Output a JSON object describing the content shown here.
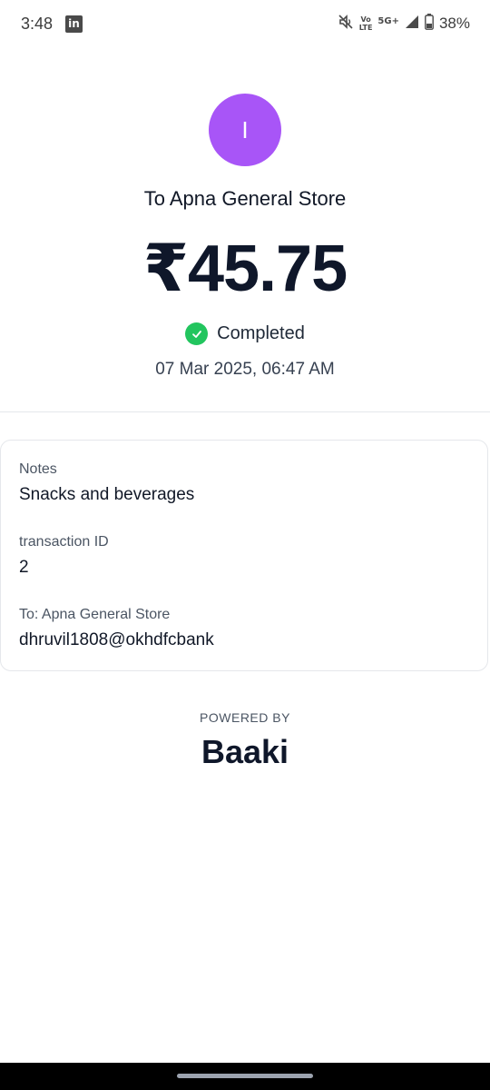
{
  "status_bar": {
    "time": "3:48",
    "battery_percent": "38%",
    "icons": [
      "linkedin-icon",
      "mute-icon",
      "volte-icon",
      "5g-icon",
      "signal-icon",
      "battery-icon"
    ],
    "volte_text": "Vo LTE",
    "network_text": "5G+"
  },
  "payment": {
    "avatar_initial": "I",
    "avatar_color": "#a855f7",
    "title": "To Apna General Store",
    "amount": "₹45.75",
    "status": "Completed",
    "status_color": "#22c55e",
    "timestamp": "07 Mar 2025, 06:47 AM"
  },
  "details": {
    "notes_label": "Notes",
    "notes_value": "Snacks and beverages",
    "txn_label": "transaction ID",
    "txn_value": "2",
    "to_label": "To: Apna General Store",
    "to_value": "dhruvil1808@okhdfcbank"
  },
  "footer": {
    "powered_by": "POWERED BY",
    "brand": "Baaki"
  }
}
